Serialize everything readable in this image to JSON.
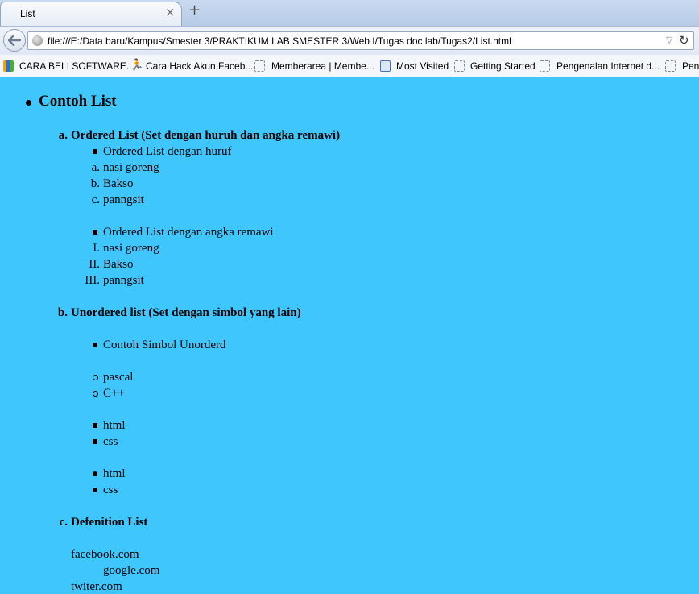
{
  "browser": {
    "tab_title": "List",
    "tab_close": "×",
    "new_tab": "+",
    "url": "file:///E:/Data baru/Kampus/Smester 3/PRAKTIKUM LAB SMESTER 3/Web I/Tugas doc lab/Tugas2/List.html",
    "bookmarks": [
      {
        "label": "CARA BELI SOFTWARE...",
        "icon": "flag-icon"
      },
      {
        "label": "Cara Hack Akun Faceb...",
        "icon": "runner-icon"
      },
      {
        "label": "Memberarea | Membe...",
        "icon": "page-icon"
      },
      {
        "label": "Most Visited",
        "icon": "search-icon"
      },
      {
        "label": "Getting Started",
        "icon": "page-icon"
      },
      {
        "label": "Pengenalan Internet d...",
        "icon": "page-icon"
      },
      {
        "label": "Pen",
        "icon": "page-icon"
      }
    ]
  },
  "page": {
    "title": "Contoh List",
    "sections": {
      "a": {
        "marker": "a.",
        "heading": "Ordered List (Set dengan huruh dan angka remawi)",
        "huruf_label": "Ordered List dengan huruf",
        "huruf_items": [
          {
            "marker": "a.",
            "text": "nasi goreng"
          },
          {
            "marker": "b.",
            "text": "Bakso"
          },
          {
            "marker": "c.",
            "text": "panngsit"
          }
        ],
        "romawi_label": "Ordered List dengan angka remawi",
        "romawi_items": [
          {
            "marker": "I.",
            "text": "nasi goreng"
          },
          {
            "marker": "II.",
            "text": "Bakso"
          },
          {
            "marker": "III.",
            "text": "panngsit"
          }
        ]
      },
      "b": {
        "marker": "b.",
        "heading": "Unordered list (Set dengan simbol yang lain)",
        "disc_label": "Contoh Simbol Unorderd",
        "circle_items": [
          "pascal",
          "C++"
        ],
        "square_items": [
          "html",
          "css"
        ],
        "disc_items": [
          "html",
          "css"
        ]
      },
      "c": {
        "marker": "c.",
        "heading": "Defenition List",
        "terms": [
          {
            "term": "facebook.com",
            "definition": "google.com"
          },
          {
            "term": "twiter.com"
          }
        ]
      }
    }
  }
}
